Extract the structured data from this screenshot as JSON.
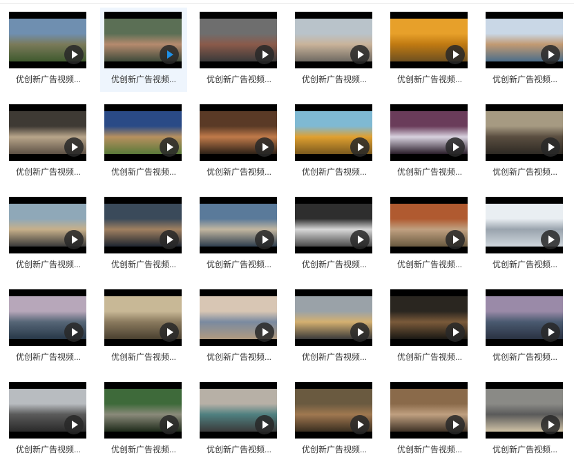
{
  "files": [
    {
      "name": "优创新广告视频...",
      "colors": [
        "#6f8fb0",
        "#7a7a5a",
        "#3f5a2e"
      ]
    },
    {
      "name": "优创新广告视频...",
      "colors": [
        "#5b6f55",
        "#b58a6e",
        "#3e4a3a"
      ]
    },
    {
      "name": "优创新广告视频...",
      "colors": [
        "#6e6e6e",
        "#8a5a4a",
        "#3a3a3a"
      ]
    },
    {
      "name": "优创新广告视频...",
      "colors": [
        "#b9c3ca",
        "#c9b39a",
        "#6f6a62"
      ]
    },
    {
      "name": "优创新广告视频...",
      "colors": [
        "#e7a02a",
        "#c07a12",
        "#6e5020"
      ]
    },
    {
      "name": "优创新广告视频...",
      "colors": [
        "#c9d7e6",
        "#c29a72",
        "#4c6e8a"
      ]
    },
    {
      "name": "优创新广告视频...",
      "colors": [
        "#3e3a34",
        "#b8a58a",
        "#5e5246"
      ]
    },
    {
      "name": "优创新广告视频...",
      "colors": [
        "#2a4a86",
        "#b7905f",
        "#5a7a3a"
      ]
    },
    {
      "name": "优创新广告视频...",
      "colors": [
        "#5a3a26",
        "#c07a4a",
        "#2e2218"
      ]
    },
    {
      "name": "优创新广告视频...",
      "colors": [
        "#7fb9d3",
        "#e0a030",
        "#7b5a1e"
      ]
    },
    {
      "name": "优创新广告视频...",
      "colors": [
        "#6a3c5a",
        "#d8d2df",
        "#2a1e2a"
      ]
    },
    {
      "name": "优创新广告视频...",
      "colors": [
        "#a69a82",
        "#5a4e40",
        "#2e2a24"
      ]
    },
    {
      "name": "优创新广告视频...",
      "colors": [
        "#8fa8b8",
        "#c7b08a",
        "#3a3a3a"
      ]
    },
    {
      "name": "优创新广告视频...",
      "colors": [
        "#3a4a5a",
        "#a08060",
        "#1e2530"
      ]
    },
    {
      "name": "优创新广告视频...",
      "colors": [
        "#5a7a9a",
        "#c2b6a0",
        "#2e3e4e"
      ]
    },
    {
      "name": "优创新广告视频...",
      "colors": [
        "#2e2e2e",
        "#d8d8d8",
        "#4a4a4a"
      ]
    },
    {
      "name": "优创新广告视频...",
      "colors": [
        "#b05a30",
        "#c0a080",
        "#6a5a40"
      ]
    },
    {
      "name": "优创新广告视频...",
      "colors": [
        "#e9eef2",
        "#9aa4ae",
        "#cfd6dc"
      ]
    },
    {
      "name": "优创新广告视频...",
      "colors": [
        "#b7a7ba",
        "#566677",
        "#283848"
      ]
    },
    {
      "name": "优创新广告视频...",
      "colors": [
        "#c8b896",
        "#8a7a5e",
        "#4a4030"
      ]
    },
    {
      "name": "优创新广告视频...",
      "colors": [
        "#d8c6b4",
        "#7a8aa0",
        "#b09a80"
      ]
    },
    {
      "name": "优创新广告视频...",
      "colors": [
        "#9aa2a8",
        "#d4b070",
        "#3a3a3a"
      ]
    },
    {
      "name": "优创新广告视频...",
      "colors": [
        "#2a2620",
        "#7a5a3a",
        "#1a1814"
      ]
    },
    {
      "name": "优创新广告视频...",
      "colors": [
        "#9a8aa8",
        "#4a5a70",
        "#2a3242"
      ]
    },
    {
      "name": "优创新广告视频...",
      "colors": [
        "#b8bcc0",
        "#5a5a5a",
        "#2a2a2a"
      ]
    },
    {
      "name": "优创新广告视频...",
      "colors": [
        "#3e6a3a",
        "#8a8a7a",
        "#1e2a1a"
      ]
    },
    {
      "name": "优创新广告视频...",
      "colors": [
        "#b7b0a6",
        "#4f8080",
        "#3a3a3a"
      ]
    },
    {
      "name": "优创新广告视频...",
      "colors": [
        "#6a5a40",
        "#a07850",
        "#3a2e20"
      ]
    },
    {
      "name": "优创新广告视频...",
      "colors": [
        "#8a6a4a",
        "#c0a080",
        "#3e3226"
      ]
    },
    {
      "name": "优创新广告视频...",
      "colors": [
        "#8a8a86",
        "#5a5a5a",
        "#cfc2a6"
      ]
    }
  ],
  "selected_index": 1,
  "colors": {
    "selected_bg": "#eef5fd",
    "play_icon_selected": "#1e8fe6",
    "label_text": "#333333"
  }
}
